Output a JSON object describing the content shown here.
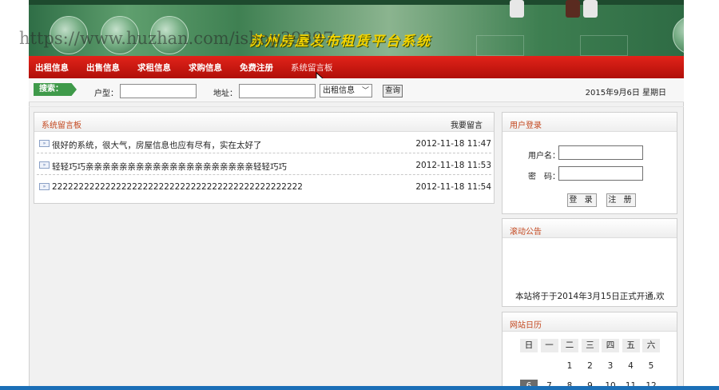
{
  "banner": {
    "title": "苏州房屋发布租赁平台系统"
  },
  "watermark": {
    "text": "https://www.huzhan.com/ishop39397"
  },
  "nav": {
    "items": [
      {
        "label": "出租信息"
      },
      {
        "label": "出售信息"
      },
      {
        "label": "求租信息"
      },
      {
        "label": "求购信息"
      },
      {
        "label": "免费注册"
      },
      {
        "label": "系统留言板"
      }
    ],
    "active": "系统留言板"
  },
  "search": {
    "tag": "搜索：",
    "type_label": "户型：",
    "type_value": "",
    "address_label": "地址：",
    "address_value": "",
    "category_selected": "出租信息",
    "query_label": "查询",
    "date_text": "2015年9月6日 星期日"
  },
  "board": {
    "title": "系统留言板",
    "action_label": "我要留言",
    "messages": [
      {
        "text": "很好的系统，很大气，房屋信息也应有尽有，实在太好了",
        "time": "2012-11-18 11:47"
      },
      {
        "text": "轻轻巧巧亲亲亲亲亲亲亲亲亲亲亲亲亲亲亲亲亲亲亲亲轻轻巧巧",
        "time": "2012-11-18 11:53"
      },
      {
        "text": "22222222222222222222222222222222222222222222222",
        "time": "2012-11-18 11:54"
      }
    ]
  },
  "login": {
    "title": "用户登录",
    "username_label": "用户名：",
    "password_label": "密　码：",
    "login_button": "登 录",
    "register_button": "注 册"
  },
  "notice": {
    "title": "滚动公告",
    "text": "本站将于于2014年3月15日正式开通,欢"
  },
  "calendar": {
    "title": "网站日历",
    "weekdays": [
      "日",
      "一",
      "二",
      "三",
      "四",
      "五",
      "六"
    ],
    "weeks": [
      [
        "",
        "",
        "1",
        "2",
        "3",
        "4",
        "5"
      ],
      [
        "6",
        "7",
        "8",
        "9",
        "10",
        "11",
        "12"
      ]
    ],
    "today": "6"
  },
  "colors": {
    "nav_red": "#d21a12",
    "title_orange": "#c3471e",
    "search_tag_green": "#3f9a4a",
    "banner_text_yellow": "#f4d400"
  }
}
